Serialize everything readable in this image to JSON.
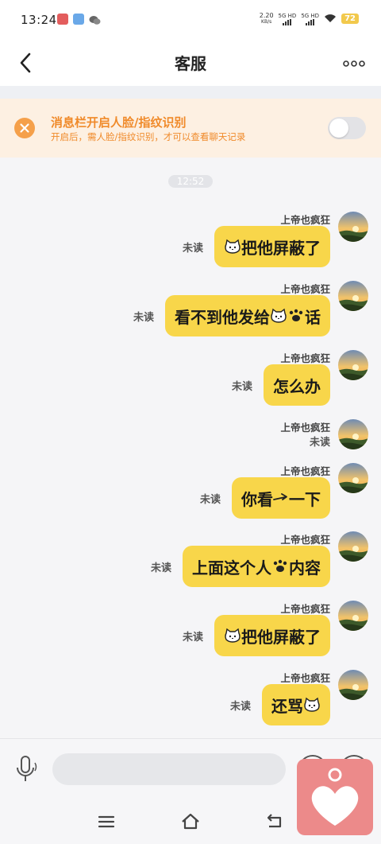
{
  "status_bar": {
    "time": "13:24",
    "speed_value": "2.20",
    "speed_unit": "KB/s",
    "sim1": "5G HD",
    "sim2": "5G HD",
    "battery": "72"
  },
  "header": {
    "title": "客服"
  },
  "notice": {
    "title": "消息栏开启人脸/指纹识别",
    "subtitle": "开启后，需人脸/指纹识别，才可以查看聊天记录",
    "toggle_on": false
  },
  "chat": {
    "time_label": "12:52",
    "sender_name": "上帝也疯狂",
    "messages": [
      {
        "status": "未读",
        "pre": "",
        "emoji": "cat-emoji",
        "text": "把他屏蔽了",
        "post": ""
      },
      {
        "status": "未读",
        "pre": "看不到他发给",
        "emoji": "cat-emoji",
        "mid": "",
        "emoji2": "paw-emoji",
        "text": "话",
        "post": ""
      },
      {
        "status": "未读",
        "pre": "",
        "emoji": "",
        "text": "怎么办",
        "post": ""
      },
      {
        "status": "未读",
        "empty": true
      },
      {
        "status": "未读",
        "pre": "你看",
        "emoji": "arrow-emoji",
        "text": "一下",
        "post": ""
      },
      {
        "status": "未读",
        "pre": "上面这个人",
        "emoji": "paw-emoji",
        "text": "内容",
        "post": ""
      },
      {
        "status": "未读",
        "pre": "",
        "emoji": "cat-emoji",
        "text": "把他屏蔽了",
        "post": ""
      },
      {
        "status": "未读",
        "pre": "还骂",
        "emoji": "cat-emoji",
        "text": "",
        "post": ""
      }
    ]
  },
  "input": {
    "placeholder": ""
  },
  "colors": {
    "bubble": "#f8d64a",
    "notice_bg": "#fdf0e2",
    "notice_text": "#f08a2a",
    "heart_bg": "#ec8a8a"
  }
}
